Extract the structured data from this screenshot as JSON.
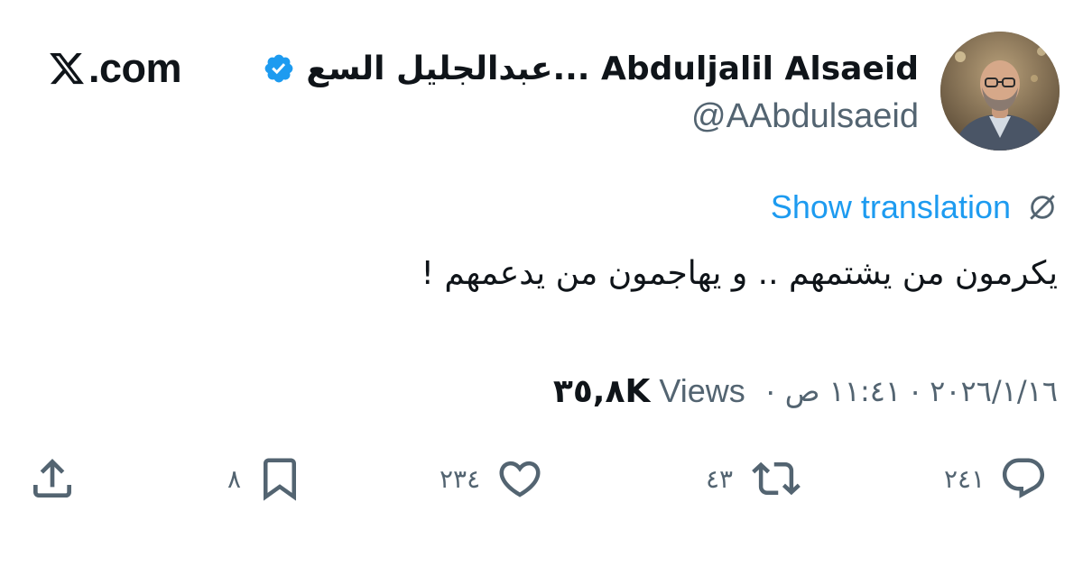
{
  "site": {
    "logo_text": ".com",
    "logo_icon": "x-logo-icon"
  },
  "author": {
    "display_name": "عبدالجليل السع... Abduljalil Alsaeid",
    "handle": "@AAbdulsaeid",
    "verified": true,
    "verified_icon": "verified-badge-icon",
    "avatar_icon": "avatar-photo"
  },
  "translation": {
    "label": "Show translation",
    "icon": "globe-icon"
  },
  "tweet": {
    "text": "يكرمون من يشتمهم .. و يهاجمون من يدعمهم !"
  },
  "meta": {
    "date": "٢٠٢٦/١/١٦",
    "separator": "·",
    "time": "١١:٤١ ص",
    "views_label": "Views",
    "views_count": "٣٥,٨K"
  },
  "actions": {
    "reply_count": "٢٤١",
    "retweet_count": "٤٣",
    "like_count": "٢٣٤",
    "bookmark_count": "٨",
    "reply_icon": "reply-icon",
    "retweet_icon": "retweet-icon",
    "like_icon": "heart-icon",
    "bookmark_icon": "bookmark-icon",
    "share_icon": "share-icon"
  },
  "colors": {
    "text_primary": "#0f1419",
    "text_secondary": "#536471",
    "accent": "#1d9bf0",
    "background": "#ffffff"
  }
}
